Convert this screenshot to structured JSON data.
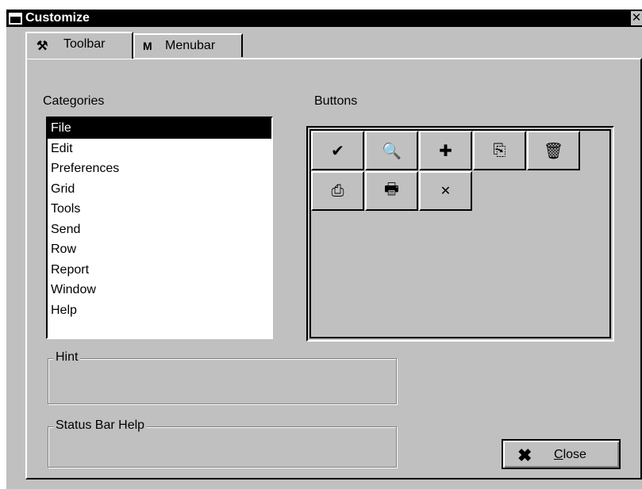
{
  "window": {
    "title": "Customize",
    "close_glyph": "✕"
  },
  "tabs": [
    {
      "label": "Toolbar",
      "icon": "toolbar-tab-icon",
      "glyph": "⚒"
    },
    {
      "label": "Menubar",
      "icon": "menubar-tab-icon",
      "glyph": "M"
    }
  ],
  "categories": {
    "label": "Categories",
    "items": [
      "File",
      "Edit",
      "Preferences",
      "Grid",
      "Tools",
      "Send",
      "Row",
      "Report",
      "Window",
      "Help"
    ],
    "selected": "File"
  },
  "buttons": {
    "label": "Buttons",
    "items": [
      {
        "name": "check-icon",
        "glyph": "✔"
      },
      {
        "name": "find-icon",
        "glyph": "🔍"
      },
      {
        "name": "add-icon",
        "glyph": "✚"
      },
      {
        "name": "copy-icon",
        "glyph": "⎘"
      },
      {
        "name": "delete-icon",
        "glyph": "🗑"
      },
      {
        "name": "print-setup-icon",
        "glyph": "⎙"
      },
      {
        "name": "print-icon",
        "glyph": "🖶"
      },
      {
        "name": "close-x-icon",
        "glyph": "✕"
      }
    ]
  },
  "hint": {
    "label": "Hint",
    "value": ""
  },
  "status_bar_help": {
    "label": "Status Bar Help",
    "value": ""
  },
  "close_button": {
    "label": "Close",
    "mnemonic": "C",
    "rest": "lose",
    "glyph": "✖"
  }
}
